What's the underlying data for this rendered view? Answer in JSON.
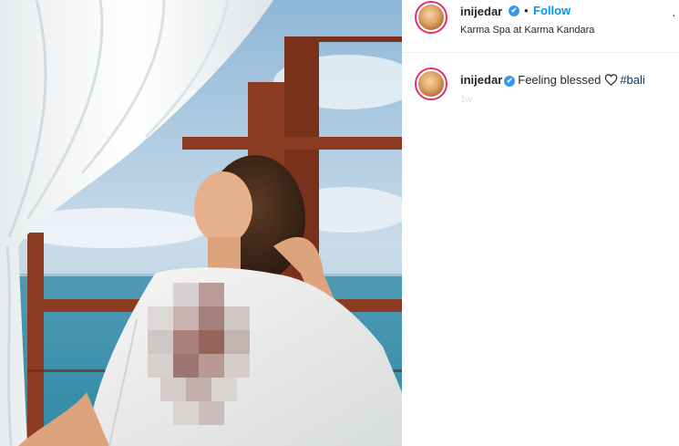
{
  "post": {
    "username": "inijedar",
    "verified_glyph": "✔",
    "separator": "•",
    "follow_label": "Follow",
    "location": "Karma Spa at Karma Kandara",
    "more_glyph": "·"
  },
  "caption": {
    "username": "inijedar",
    "text": "Feeling blessed",
    "heart_icon": "heart-outline-icon",
    "hashtag": "#bali",
    "time": "1w"
  },
  "colors": {
    "follow_blue": "#0095f6",
    "verified_blue": "#3897f0",
    "avatar_ring": "#e1306c",
    "hashtag_blue": "#00376b"
  }
}
